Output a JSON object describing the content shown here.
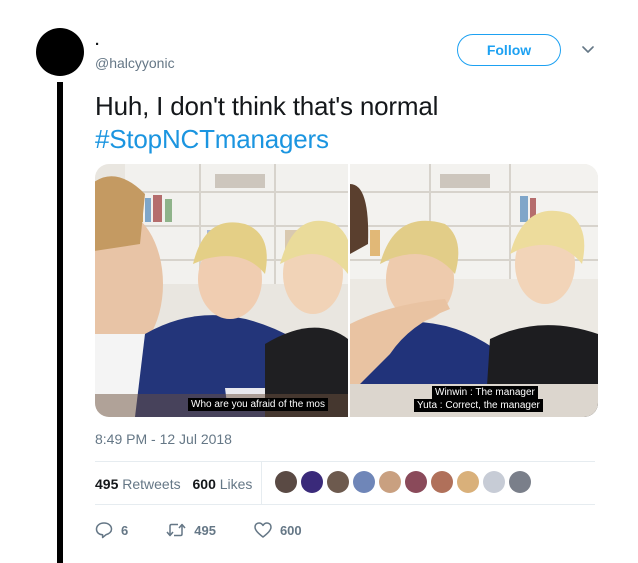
{
  "author": {
    "display_name": ".",
    "handle": "@halcyyonic"
  },
  "follow_label": "Follow",
  "tweet": {
    "text": "Huh, I don't think that's normal",
    "hashtag": "#StopNCTmanagers"
  },
  "media": {
    "left_caption": "Who are you afraid of the mos",
    "right_caption_line1": "Winwin : The manager",
    "right_caption_line2": "Yuta : Correct, the manager"
  },
  "timestamp": "8:49 PM - 12 Jul 2018",
  "stats": {
    "retweets_count": "495",
    "retweets_label": "Retweets",
    "likes_count": "600",
    "likes_label": "Likes"
  },
  "actions": {
    "reply_count": "6",
    "retweet_count": "495",
    "like_count": "600"
  },
  "colors": {
    "accent": "#1da1f2",
    "hashtag": "#1b95e0",
    "secondary_text": "#657786",
    "border": "#e6ecf0"
  }
}
